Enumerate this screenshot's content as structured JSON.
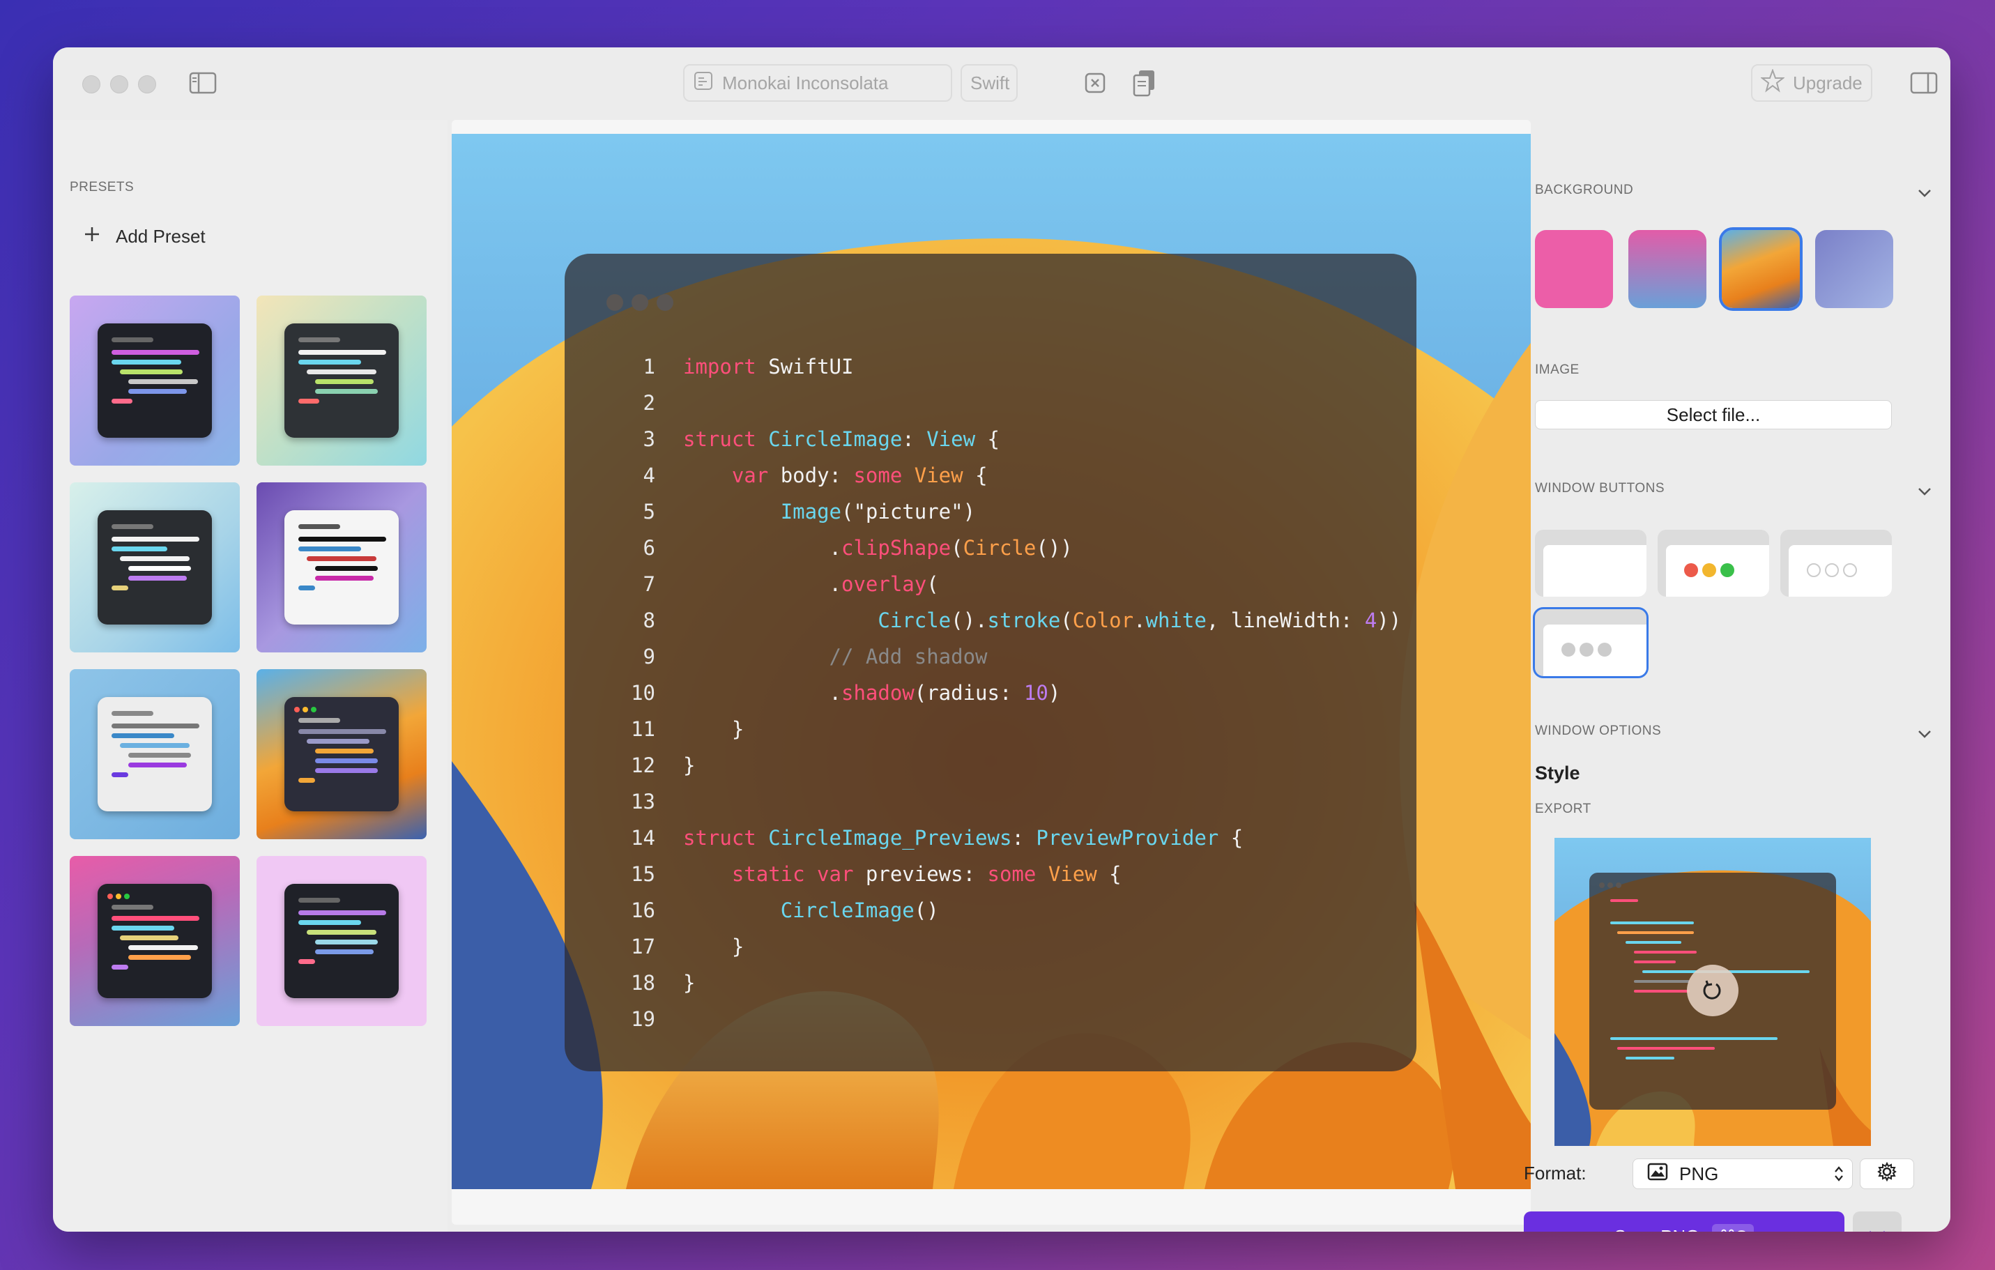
{
  "toolbar": {
    "theme_label": "Monokai Inconsolata",
    "language_label": "Swift",
    "upgrade_label": "Upgrade"
  },
  "sidebar": {
    "section_label": "PRESETS",
    "add_preset_label": "Add Preset"
  },
  "code": {
    "lines": [
      {
        "n": "1",
        "tokens": [
          [
            "kw",
            "import"
          ],
          [
            "pl",
            " SwiftUI"
          ]
        ]
      },
      {
        "n": "2",
        "tokens": []
      },
      {
        "n": "3",
        "tokens": [
          [
            "kw",
            "struct"
          ],
          [
            "pl",
            " "
          ],
          [
            "ty",
            "CircleImage"
          ],
          [
            "pl",
            ": "
          ],
          [
            "ty",
            "View"
          ],
          [
            "pl",
            " {"
          ]
        ]
      },
      {
        "n": "4",
        "tokens": [
          [
            "pl",
            "    "
          ],
          [
            "kw",
            "var"
          ],
          [
            "pl",
            " body: "
          ],
          [
            "kw",
            "some"
          ],
          [
            "pl",
            " "
          ],
          [
            "or",
            "View"
          ],
          [
            "pl",
            " {"
          ]
        ]
      },
      {
        "n": "5",
        "tokens": [
          [
            "pl",
            "        "
          ],
          [
            "fn",
            "Image"
          ],
          [
            "pl",
            "(\"picture\")"
          ]
        ]
      },
      {
        "n": "6",
        "tokens": [
          [
            "pl",
            "            ."
          ],
          [
            "kw",
            "clipShape"
          ],
          [
            "pl",
            "("
          ],
          [
            "or",
            "Circle"
          ],
          [
            "pl",
            "())"
          ]
        ]
      },
      {
        "n": "7",
        "tokens": [
          [
            "pl",
            "            ."
          ],
          [
            "kw",
            "overlay"
          ],
          [
            "pl",
            "("
          ]
        ]
      },
      {
        "n": "8",
        "tokens": [
          [
            "pl",
            "                "
          ],
          [
            "fn",
            "Circle"
          ],
          [
            "pl",
            "()."
          ],
          [
            "fn",
            "stroke"
          ],
          [
            "pl",
            "("
          ],
          [
            "or",
            "Color"
          ],
          [
            "pl",
            "."
          ],
          [
            "fn",
            "white"
          ],
          [
            "pl",
            ", lineWidth: "
          ],
          [
            "num",
            "4"
          ],
          [
            "pl",
            "))"
          ]
        ]
      },
      {
        "n": "9",
        "tokens": [
          [
            "cm",
            "            // Add shadow"
          ]
        ]
      },
      {
        "n": "10",
        "tokens": [
          [
            "pl",
            "            ."
          ],
          [
            "kw",
            "shadow"
          ],
          [
            "pl",
            "(radius: "
          ],
          [
            "num",
            "10"
          ],
          [
            "pl",
            ")"
          ]
        ]
      },
      {
        "n": "11",
        "tokens": [
          [
            "pl",
            "    }"
          ]
        ]
      },
      {
        "n": "12",
        "tokens": [
          [
            "pl",
            "}"
          ]
        ]
      },
      {
        "n": "13",
        "tokens": []
      },
      {
        "n": "14",
        "tokens": [
          [
            "kw",
            "struct"
          ],
          [
            "pl",
            " "
          ],
          [
            "ty",
            "CircleImage_Previews"
          ],
          [
            "pl",
            ": "
          ],
          [
            "ty",
            "PreviewProvider"
          ],
          [
            "pl",
            " {"
          ]
        ]
      },
      {
        "n": "15",
        "tokens": [
          [
            "pl",
            "    "
          ],
          [
            "kw",
            "static var"
          ],
          [
            "pl",
            " previews: "
          ],
          [
            "kw",
            "some"
          ],
          [
            "pl",
            " "
          ],
          [
            "or",
            "View"
          ],
          [
            "pl",
            " {"
          ]
        ]
      },
      {
        "n": "16",
        "tokens": [
          [
            "pl",
            "        "
          ],
          [
            "fn",
            "CircleImage"
          ],
          [
            "pl",
            "()"
          ]
        ]
      },
      {
        "n": "17",
        "tokens": [
          [
            "pl",
            "    }"
          ]
        ]
      },
      {
        "n": "18",
        "tokens": [
          [
            "pl",
            "}"
          ]
        ]
      },
      {
        "n": "19",
        "tokens": []
      }
    ]
  },
  "panel": {
    "background_label": "BACKGROUND",
    "image_label": "IMAGE",
    "select_file_label": "Select file...",
    "window_buttons_label": "WINDOW BUTTONS",
    "window_options_label": "WINDOW OPTIONS",
    "style_label": "Style",
    "export_label": "EXPORT",
    "format_label": "Format:",
    "format_value": "PNG",
    "save_label": "Save PNG",
    "save_shortcut": "⌘S"
  },
  "colors": {
    "accent": "#6a2fe0",
    "keyword": "#ff4f7b",
    "type": "#6ad6ee",
    "number": "#bd7cf0",
    "orange": "#ffa04a"
  }
}
